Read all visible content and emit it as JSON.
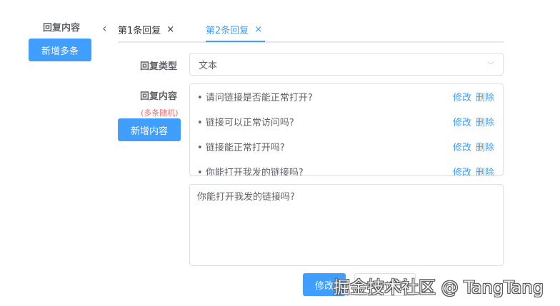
{
  "left": {
    "label": "回复内容",
    "add_multi": "新增多条"
  },
  "tabs": [
    {
      "label": "第1条回复",
      "active": false
    },
    {
      "label": "第2条回复",
      "active": true
    }
  ],
  "form": {
    "type_label": "回复类型",
    "type_value": "文本",
    "content_label": "回复内容",
    "content_note": "(多条随机)",
    "add_content": "新增内容",
    "items": [
      {
        "text": "请问链接是否能正常打开?"
      },
      {
        "text": "链接可以正常访问吗?"
      },
      {
        "text": "链接能正常打开吗?"
      },
      {
        "text": "你能打开我发的链接吗?"
      }
    ],
    "edit": "修改",
    "delete": "删除",
    "textarea_value": "你能打开我发的链接吗?",
    "save": "修改",
    "cancel": "取消修改"
  },
  "watermark": "掘金技术社区 @ TangTang",
  "colors": {
    "primary": "#409eff",
    "note": "#f56c6c"
  }
}
